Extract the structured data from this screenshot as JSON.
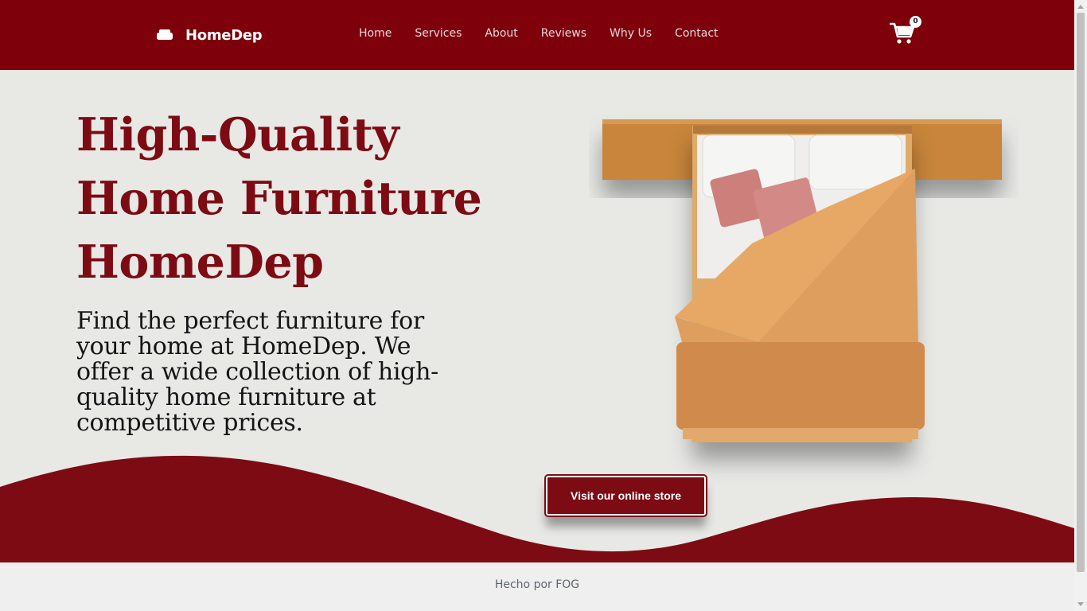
{
  "header": {
    "brand_name": "HomeDep",
    "brand_icon": "sofa-icon",
    "nav": [
      {
        "label": "Home"
      },
      {
        "label": "Services"
      },
      {
        "label": "About"
      },
      {
        "label": "Reviews"
      },
      {
        "label": "Why Us"
      },
      {
        "label": "Contact"
      }
    ],
    "cart_icon": "cart-icon",
    "cart_count": "0"
  },
  "hero": {
    "title_lines": [
      "High-Quality",
      "Home Furniture",
      "HomeDep"
    ],
    "description": "Find the perfect furniture for your home at HomeDep. We offer a wide collection of high-quality home furniture at competitive prices.",
    "cta_label": "Visit our online store"
  },
  "footer": {
    "text": "Hecho por FOG"
  },
  "colors": {
    "brand_red": "#7d000b",
    "hero_bg": "#e8e8e5",
    "title_red": "#7d0b14"
  }
}
